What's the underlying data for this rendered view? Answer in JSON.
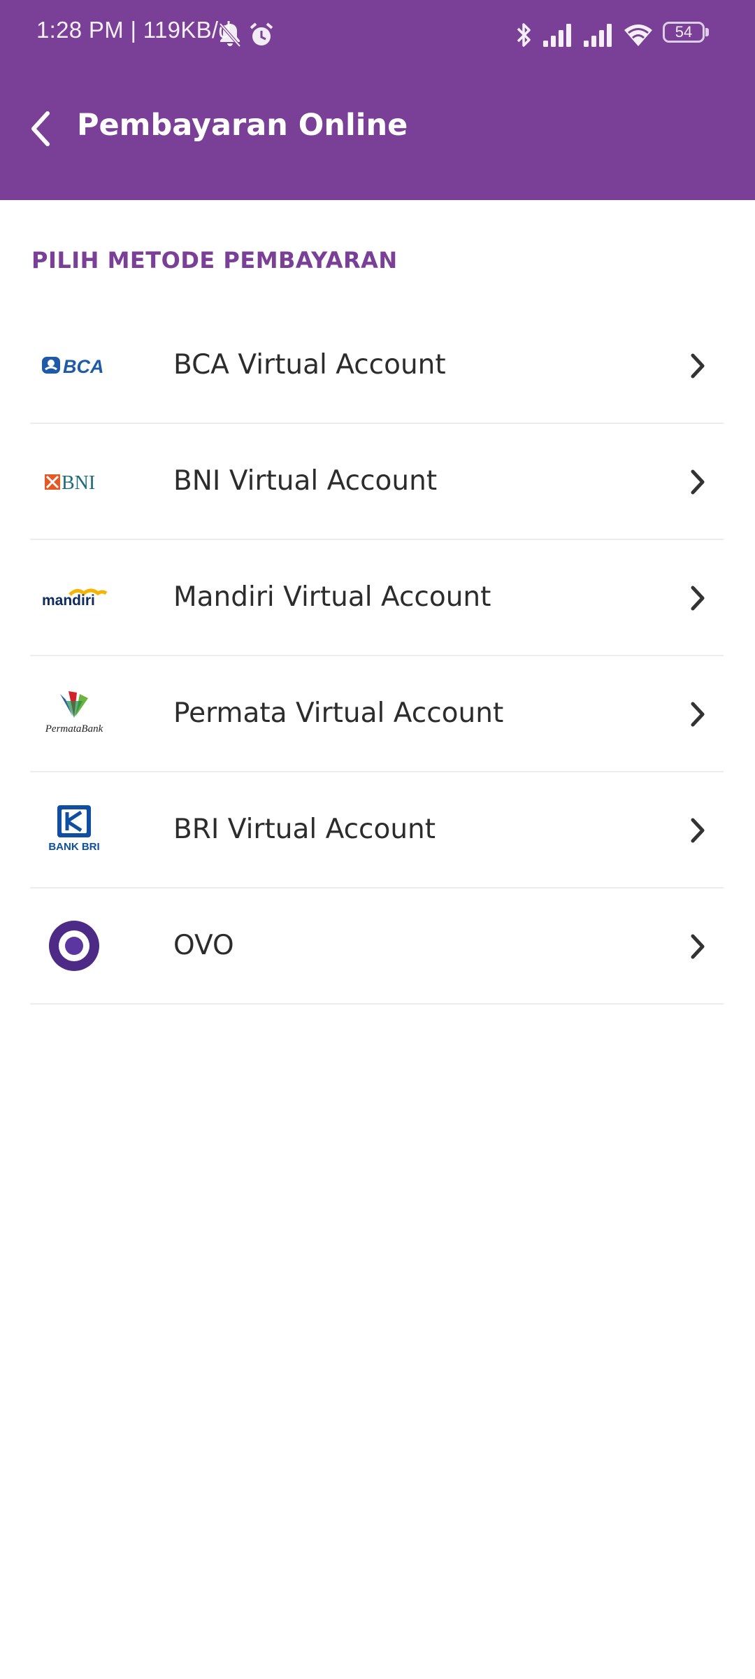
{
  "status_bar": {
    "time_and_speed": "1:28 PM | 119KB/d",
    "battery_level": "54",
    "icons": [
      "bell-off-icon",
      "alarm-icon",
      "bluetooth-icon",
      "signal-icon",
      "signal-icon",
      "wifi-icon",
      "battery-icon"
    ]
  },
  "header": {
    "title": "Pembayaran Online",
    "back_icon": "chevron-left-icon",
    "background_color": "#7a4097"
  },
  "section": {
    "title": "PILIH METODE PEMBAYARAN"
  },
  "payment_methods": [
    {
      "label": "BCA Virtual Account",
      "logo": "bca-logo",
      "logo_text": "BCA"
    },
    {
      "label": "BNI Virtual Account",
      "logo": "bni-logo",
      "logo_text": "BNI"
    },
    {
      "label": "Mandiri Virtual Account",
      "logo": "mandiri-logo",
      "logo_text": "mandiri"
    },
    {
      "label": "Permata Virtual Account",
      "logo": "permata-logo",
      "logo_text": "PermataBank"
    },
    {
      "label": "BRI Virtual Account",
      "logo": "bri-logo",
      "logo_text": "BANK BRI"
    },
    {
      "label": "OVO",
      "logo": "ovo-logo",
      "logo_text": ""
    }
  ],
  "colors": {
    "accent": "#7a4097",
    "text": "#2c2c2c",
    "divider": "#ececec"
  }
}
